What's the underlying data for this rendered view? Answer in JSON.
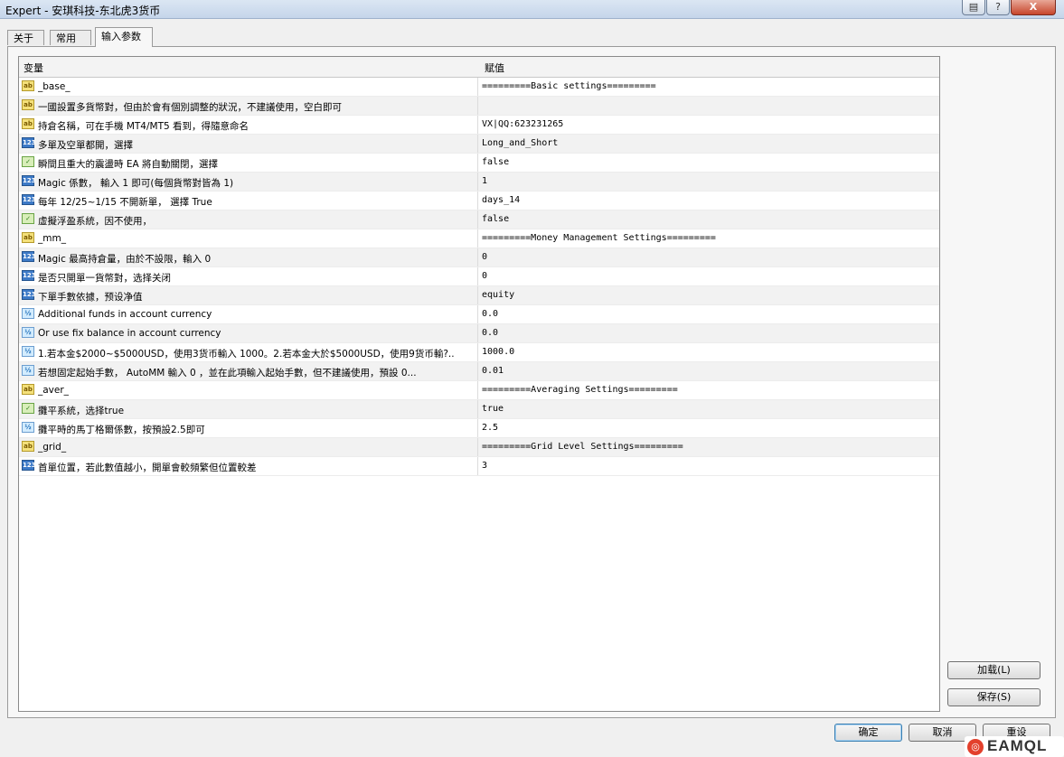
{
  "window": {
    "title": "Expert - 安琪科技-东北虎3货币",
    "help_label": "?",
    "close_label": "X"
  },
  "tabs": [
    {
      "label": "关于",
      "active": false
    },
    {
      "label": "常用",
      "active": false
    },
    {
      "label": "输入参数",
      "active": true
    }
  ],
  "grid": {
    "col_name": "变量",
    "col_value": "赋值",
    "rows": [
      {
        "type": "ab",
        "icon": "ab",
        "name": "_base_",
        "value": "=========Basic settings========="
      },
      {
        "type": "ab",
        "icon": "ab",
        "name": "一國設置多貨幣對，但由於會有個別調整的狀況，不建議使用，空白即可",
        "value": ""
      },
      {
        "type": "ab",
        "icon": "ab",
        "name": "持倉名稱，可在手機 MT4/MT5 看到，得隨意命名",
        "value": "VX|QQ:623231265"
      },
      {
        "type": "num",
        "icon": "123",
        "name": "多單及空單都開，選擇",
        "value": "Long_and_Short"
      },
      {
        "type": "bool",
        "icon": "✓",
        "name": "瞬間且重大的震盪時 EA 將自動關閉，選擇",
        "value": "false"
      },
      {
        "type": "num",
        "icon": "123",
        "name": "Magic 係數，  輸入 1 即可(每個貨幣對皆為 1)",
        "value": "1"
      },
      {
        "type": "num",
        "icon": "123",
        "name": "每年 12/25~1/15 不開新單，  選擇 True",
        "value": "days_14"
      },
      {
        "type": "bool",
        "icon": "✓",
        "name": "虛擬浮盈系統，因不使用，",
        "value": "false"
      },
      {
        "type": "ab",
        "icon": "ab",
        "name": "_mm_",
        "value": "=========Money Management Settings========="
      },
      {
        "type": "num",
        "icon": "123",
        "name": "Magic 最高持倉量，由於不設限，輸入 0",
        "value": "0"
      },
      {
        "type": "num",
        "icon": "123",
        "name": "是否只開單一貨幣對，选择关闭",
        "value": "0"
      },
      {
        "type": "num",
        "icon": "123",
        "name": "下單手數依據，预设净值",
        "value": "equity"
      },
      {
        "type": "dbl",
        "icon": "½",
        "name": "Additional funds in account currency",
        "value": "0.0"
      },
      {
        "type": "dbl",
        "icon": "½",
        "name": "Or use fix balance in account currency",
        "value": "0.0"
      },
      {
        "type": "dbl",
        "icon": "½",
        "name": "1.若本金$2000~$5000USD，使用3货币輸入 1000。2.若本金大於$5000USD，使用9货币輸?..",
        "value": "1000.0"
      },
      {
        "type": "dbl",
        "icon": "½",
        "name": "若想固定起始手數， AutoMM 輸入 0 ，並在此項輸入起始手數，但不建議使用，預設 0...",
        "value": "0.01"
      },
      {
        "type": "ab",
        "icon": "ab",
        "name": "_aver_",
        "value": "=========Averaging Settings========="
      },
      {
        "type": "bool",
        "icon": "✓",
        "name": "攤平系統，选择true",
        "value": "true"
      },
      {
        "type": "dbl",
        "icon": "½",
        "name": "攤平時的馬丁格爾係數，按預設2.5即可",
        "value": "2.5"
      },
      {
        "type": "ab",
        "icon": "ab",
        "name": "_grid_",
        "value": "=========Grid Level Settings========="
      },
      {
        "type": "num",
        "icon": "123",
        "name": "首單位置，若此數值越小，開單會較頻繁但位置較差",
        "value": "3"
      }
    ]
  },
  "side_buttons": {
    "load": "加载(L)",
    "save": "保存(S)"
  },
  "footer_buttons": {
    "ok": "确定",
    "cancel": "取消",
    "reset": "重设"
  },
  "watermark": {
    "text": "EAMQL"
  }
}
